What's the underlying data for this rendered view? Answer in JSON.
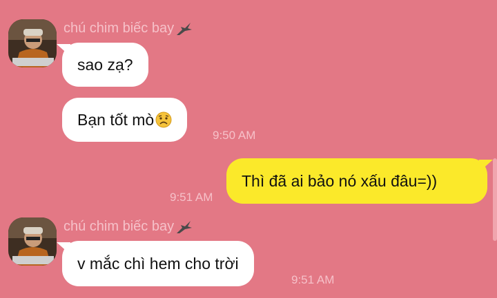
{
  "messages": {
    "group1": {
      "sender": "chú chim biếc bay",
      "lines": [
        "sao zạ?",
        "Bạn tốt mò"
      ],
      "time": "9:50 AM"
    },
    "outgoing": {
      "text": "Thì đã ai bảo nó xấu đâu=))",
      "time": "9:51 AM"
    },
    "group2": {
      "sender": "chú chim biếc bay",
      "lines": [
        "v mắc chì hem cho trời"
      ],
      "time": "9:51 AM"
    }
  },
  "icons": {
    "sender_badge": "bird-icon",
    "emoji": "sad-face-emoji"
  },
  "colors": {
    "background": "#e37885",
    "incoming_bubble": "#ffffff",
    "outgoing_bubble": "#fbe92a",
    "meta_text": "#f6c1c9"
  }
}
